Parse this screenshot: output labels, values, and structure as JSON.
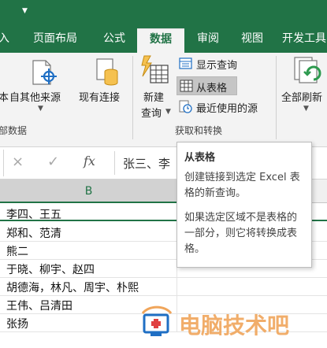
{
  "ribbon_tabs": [
    {
      "label": "入"
    },
    {
      "label": "页面布局"
    },
    {
      "label": "公式"
    },
    {
      "label": "数据",
      "active": true
    },
    {
      "label": "审阅"
    },
    {
      "label": "视图"
    },
    {
      "label": "开发工具"
    }
  ],
  "ribbon": {
    "get_external_data": {
      "from_other_sources": "自其他来源",
      "existing_connections": "现有连接",
      "group_label": "部数据"
    },
    "get_transform": {
      "new_query_line1": "新建",
      "new_query_line2": "查询",
      "show_queries": "显示查询",
      "from_table": "从表格",
      "recent_sources": "最近使用的源",
      "group_label": "获取和转换"
    },
    "refresh_all": {
      "line1": "全部刷新"
    },
    "left_cut_text": "本"
  },
  "formula_bar": {
    "cancel_icon": "×",
    "enter_icon": "✓",
    "fx_label": "fx",
    "value": "张三、李"
  },
  "column_header": {
    "label": "B"
  },
  "cells": [
    "李四、王五",
    "郑和、范清",
    "熊二",
    "于晓、柳宇、赵四",
    "胡德海，林凡、周宇、朴熙",
    "王伟、吕清田",
    "张扬"
  ],
  "tooltip": {
    "title": "从表格",
    "description": "创建链接到选定 Excel 表格的新查询。",
    "note": "如果选定区域不是表格的一部分，则它将转换成表格。"
  },
  "watermark": {
    "text": "电脑技术吧"
  },
  "colors": {
    "accent": "#217346",
    "watermark_orange": "#f0a55a",
    "watermark_blue": "#1f6fc4"
  }
}
